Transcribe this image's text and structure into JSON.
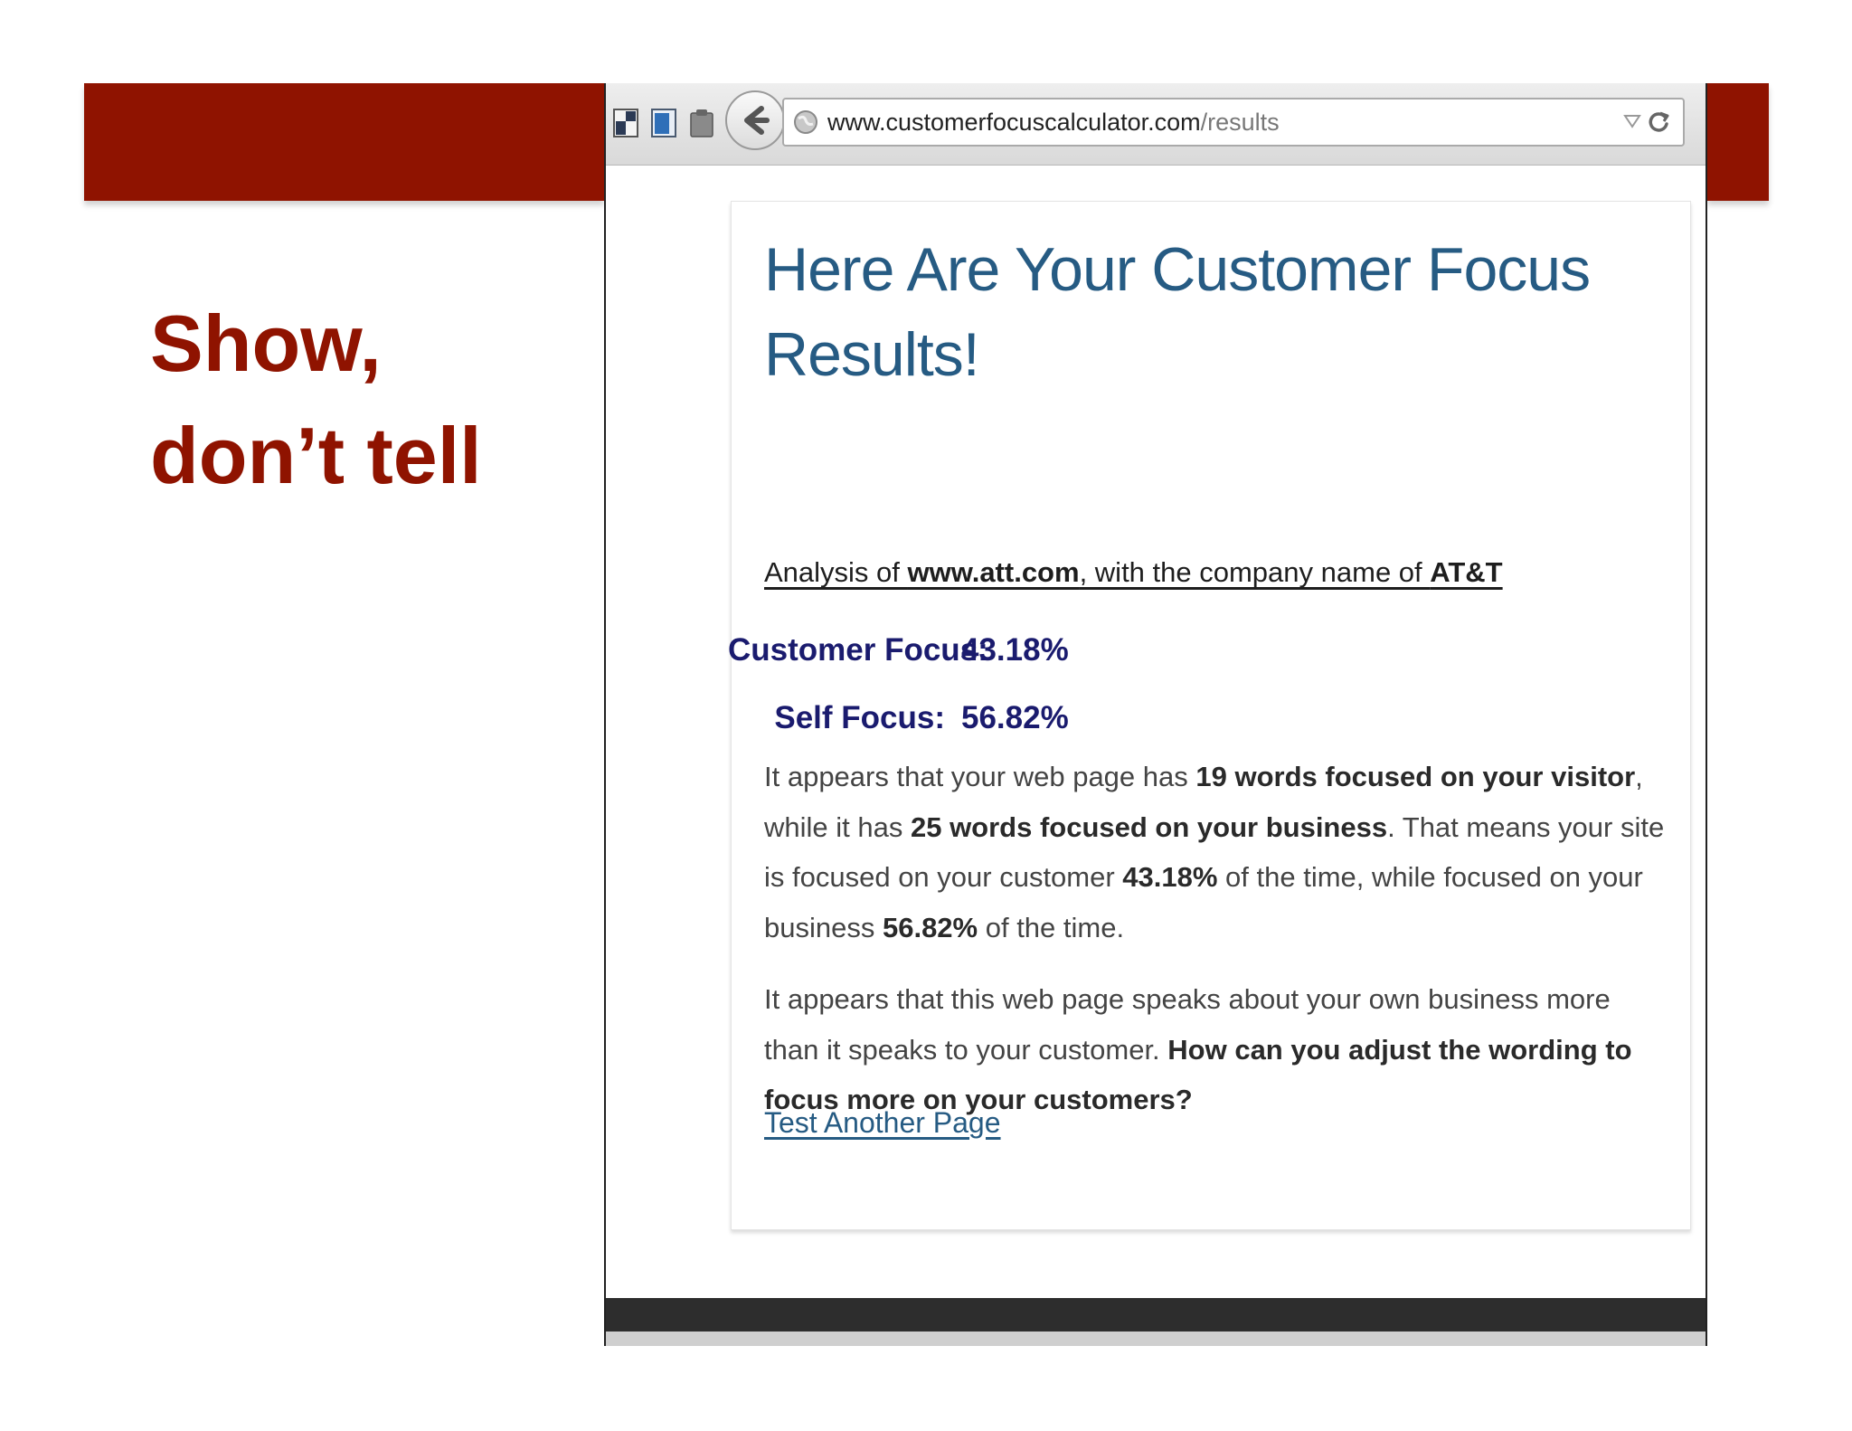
{
  "slide": {
    "title_lines": [
      "Show,",
      "don’t tell"
    ]
  },
  "browser": {
    "url_host": "www.customerfocuscalculator.com",
    "url_path": "/results",
    "icons": [
      "page-icon",
      "window-icon",
      "clipboard-icon",
      "back-arrow-icon",
      "globe-icon",
      "dropdown-icon",
      "reload-icon"
    ]
  },
  "page": {
    "heading_line1": "Here Are Your Customer Focus",
    "heading_line2": "Results!",
    "analysis": {
      "prefix": "Analysis of ",
      "site": "www.att.com",
      "middle": ", with the company name of ",
      "company": "AT&T"
    },
    "scores": {
      "customer_label": "Customer Focus:",
      "customer_value": "43.18%",
      "self_label": "Self Focus:",
      "self_value": "56.82%"
    },
    "paragraph1": {
      "t1": "It appears that your web page has ",
      "b1": "19 words focused on your visitor",
      "t2": ", while it has ",
      "b2": "25 words focused on your business",
      "t3": ". That means your site is focused on your customer ",
      "b3": "43.18%",
      "t4": " of the time, while focused on your business ",
      "b4": "56.82%",
      "t5": " of the time."
    },
    "paragraph2": {
      "t1": "It appears that this web page speaks about your own business more than it speaks to your customer. ",
      "b1": "How can you adjust the wording to focus more on your customers?"
    },
    "link_label": "Test Another Page"
  },
  "colors": {
    "brand_red": "#8f1300",
    "heading_blue": "#265b83",
    "score_navy": "#1a1b6e"
  }
}
